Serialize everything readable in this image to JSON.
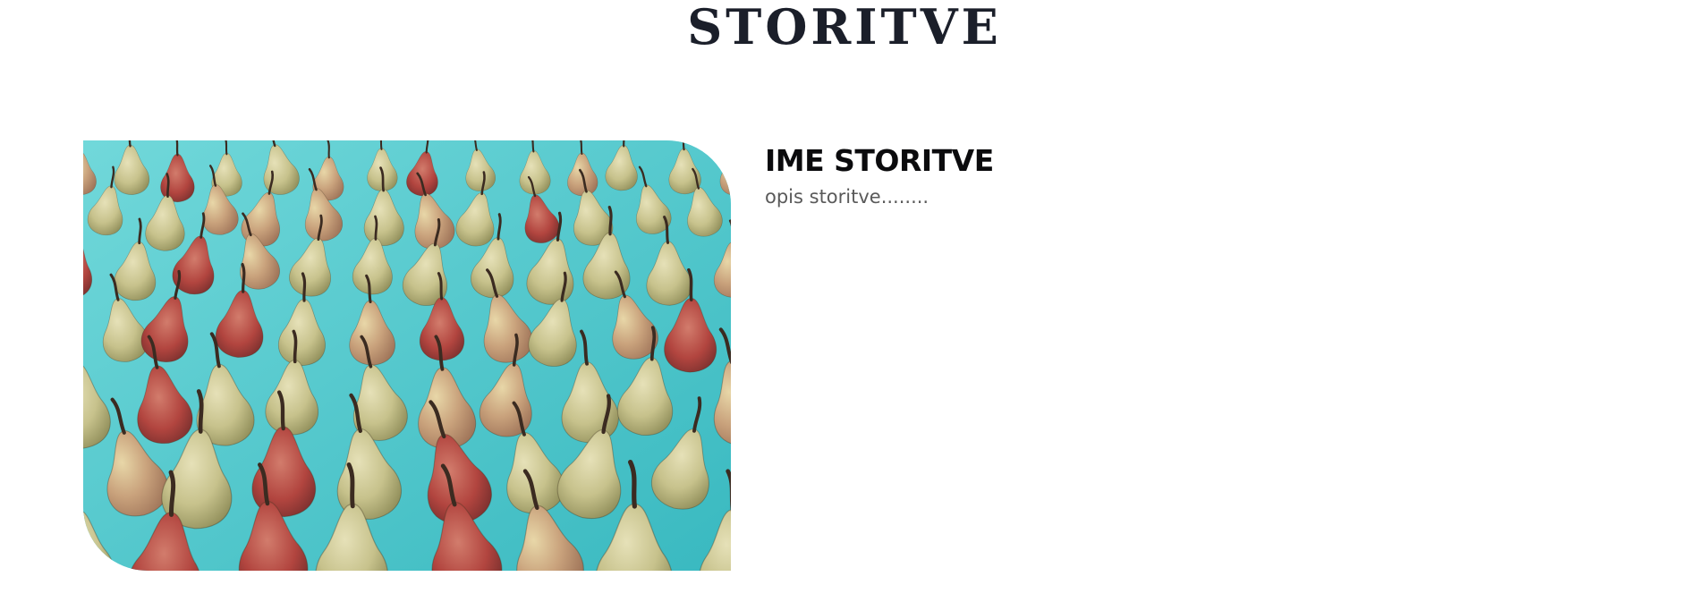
{
  "page": {
    "title": "STORITVE"
  },
  "service": {
    "name": "IME STORITVE",
    "description": "opis storitve........",
    "image": {
      "subject": "pears-photo",
      "colors": {
        "background_cloth": "#5fd0d3",
        "pear_green": "#c9c48e",
        "pear_red": "#b2453f",
        "stem": "#3b2b21"
      }
    }
  }
}
